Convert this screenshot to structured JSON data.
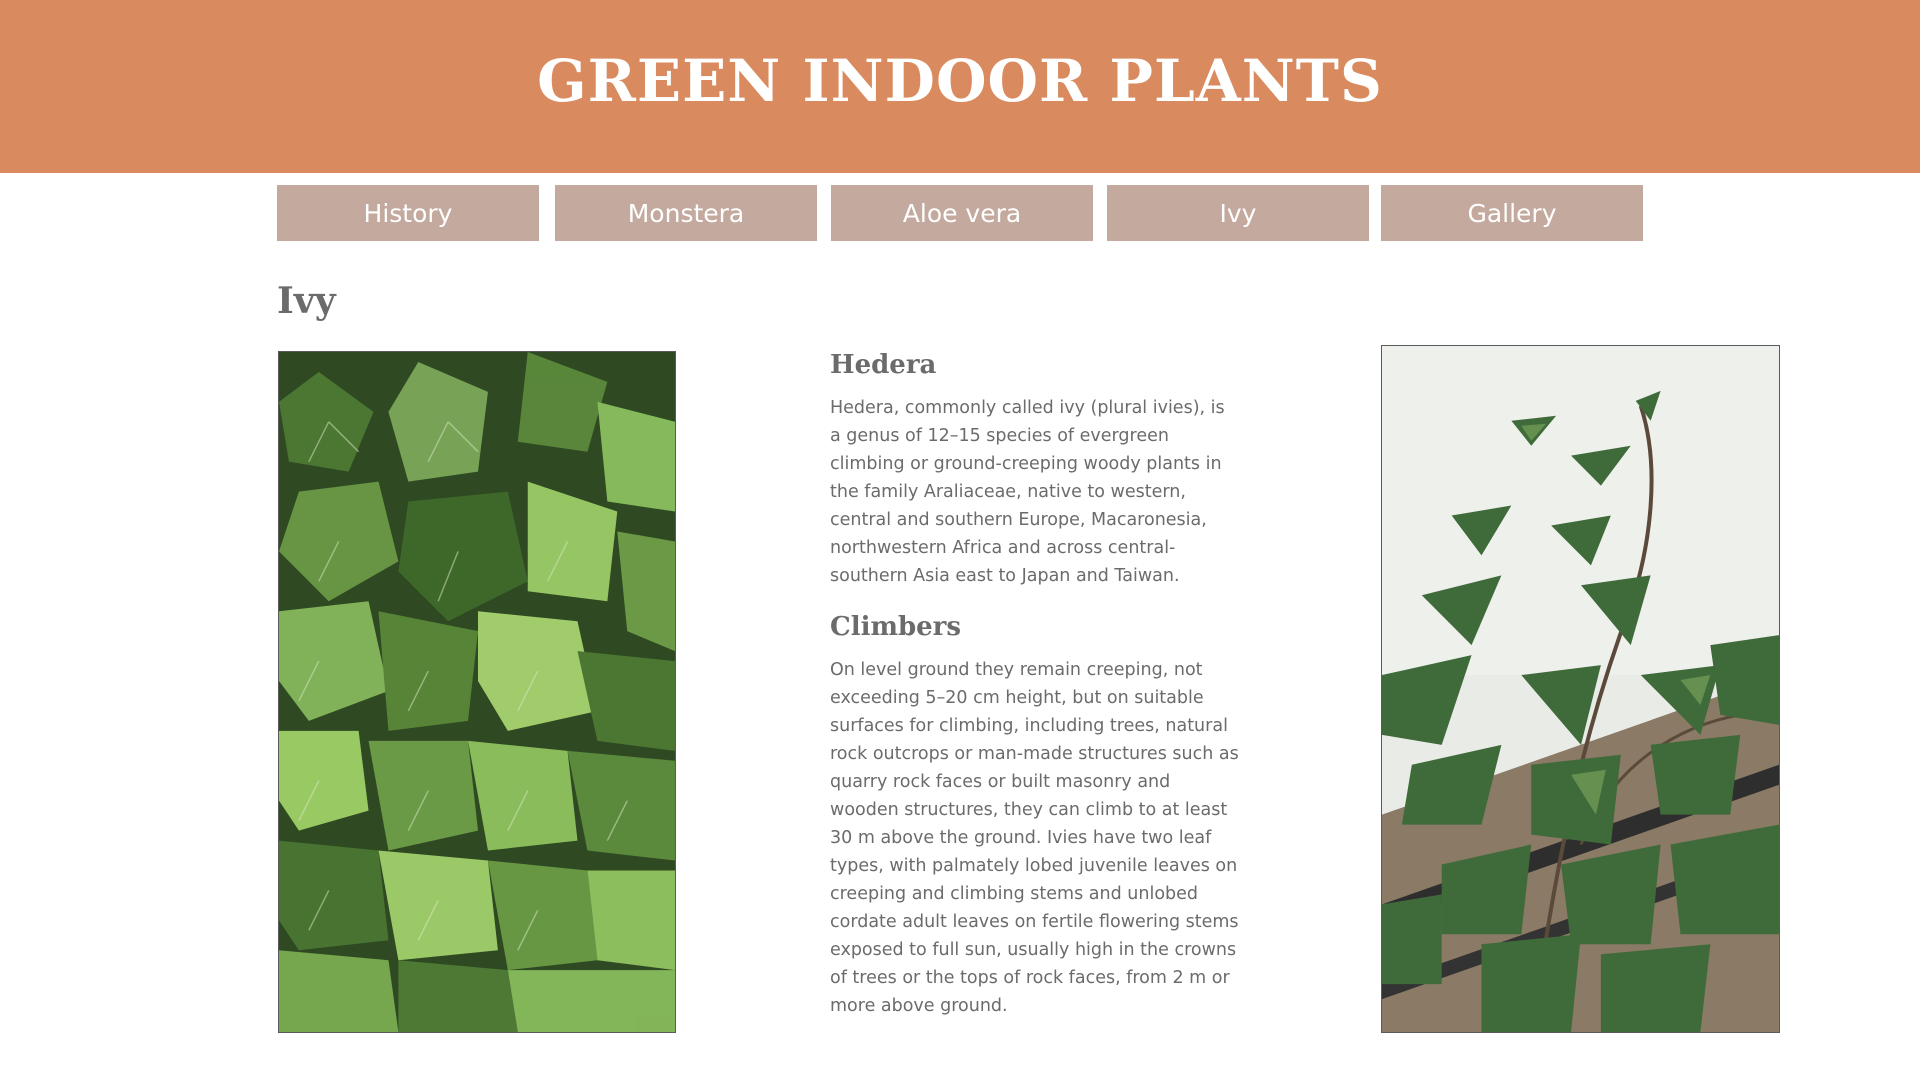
{
  "colors": {
    "header_bg": "#d98a5e",
    "nav_bg": "#c4a99e",
    "text": "#6b6b6b",
    "page_bg": "#ffffff"
  },
  "header": {
    "title": "GREEN INDOOR PLANTS"
  },
  "nav": {
    "items": [
      {
        "label": "History"
      },
      {
        "label": "Monstera"
      },
      {
        "label": "Aloe vera"
      },
      {
        "label": "Ivy"
      },
      {
        "label": "Gallery"
      }
    ]
  },
  "main": {
    "title": "Ivy",
    "left_image_icon": "ivy-leaves-photo",
    "right_image_icon": "ivy-vine-photo",
    "sections": [
      {
        "heading": "Hedera",
        "body": "Hedera, commonly called ivy (plural ivies), is a genus of 12–15 species of evergreen climbing or ground-creeping woody plants in the family Araliaceae, native to western, central and southern Europe, Macaronesia, northwestern Africa and across central-southern Asia east to Japan and Taiwan."
      },
      {
        "heading": "Climbers",
        "body": "On level ground they remain creeping, not exceeding 5–20 cm height, but on suitable surfaces for climbing, including trees, natural rock outcrops or man-made structures such as quarry rock faces or built masonry and wooden structures, they can climb to at least 30 m above the ground. Ivies have two leaf types, with palmately lobed juvenile leaves on creeping and climbing stems and unlobed cordate adult leaves on fertile flowering stems exposed to full sun, usually high in the crowns of trees or the tops of rock faces, from 2 m or more above ground."
      }
    ]
  }
}
